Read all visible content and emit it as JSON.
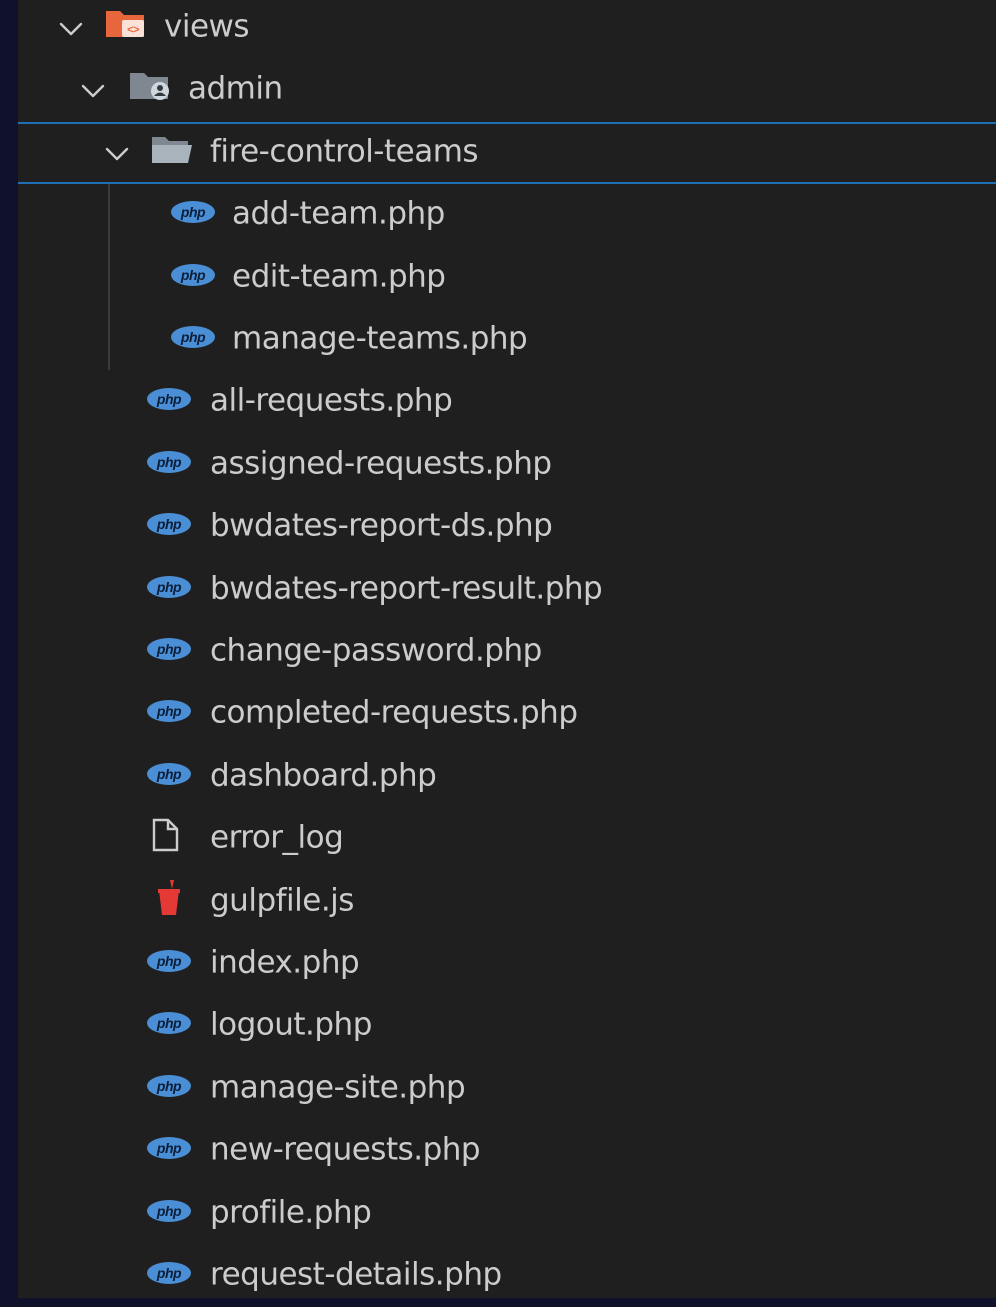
{
  "explorer": {
    "tree": [
      {
        "label": "views",
        "kind": "folder-views",
        "depth": 0,
        "expanded": true
      },
      {
        "label": "admin",
        "kind": "folder-admin",
        "depth": 1,
        "expanded": true
      },
      {
        "label": "fire-control-teams",
        "kind": "folder-open",
        "depth": 2,
        "expanded": true,
        "selected": true
      },
      {
        "label": "add-team.php",
        "kind": "php",
        "depth": 3
      },
      {
        "label": "edit-team.php",
        "kind": "php",
        "depth": 3
      },
      {
        "label": "manage-teams.php",
        "kind": "php",
        "depth": 3
      },
      {
        "label": "all-requests.php",
        "kind": "php",
        "depth": 2
      },
      {
        "label": "assigned-requests.php",
        "kind": "php",
        "depth": 2
      },
      {
        "label": "bwdates-report-ds.php",
        "kind": "php",
        "depth": 2
      },
      {
        "label": "bwdates-report-result.php",
        "kind": "php",
        "depth": 2
      },
      {
        "label": "change-password.php",
        "kind": "php",
        "depth": 2
      },
      {
        "label": "completed-requests.php",
        "kind": "php",
        "depth": 2
      },
      {
        "label": "dashboard.php",
        "kind": "php",
        "depth": 2
      },
      {
        "label": "error_log",
        "kind": "file",
        "depth": 2
      },
      {
        "label": "gulpfile.js",
        "kind": "gulp",
        "depth": 2
      },
      {
        "label": "index.php",
        "kind": "php",
        "depth": 2
      },
      {
        "label": "logout.php",
        "kind": "php",
        "depth": 2
      },
      {
        "label": "manage-site.php",
        "kind": "php",
        "depth": 2
      },
      {
        "label": "new-requests.php",
        "kind": "php",
        "depth": 2
      },
      {
        "label": "profile.php",
        "kind": "php",
        "depth": 2
      },
      {
        "label": "request-details.php",
        "kind": "php",
        "depth": 2
      }
    ]
  },
  "icons": {
    "chevron": "chevron-down-icon",
    "php": "php-file-icon",
    "file": "file-icon",
    "gulp": "gulp-icon",
    "folder-views": "views-folder-icon",
    "folder-admin": "admin-folder-icon",
    "folder-open": "folder-open-icon"
  },
  "colors": {
    "background": "#10122b",
    "panel": "#1f1f1f",
    "text": "#cccccc",
    "selection_border": "#1f6fb5",
    "php_badge": "#4a8fd6",
    "gulp": "#e53935",
    "views_folder": "#e8663c"
  }
}
